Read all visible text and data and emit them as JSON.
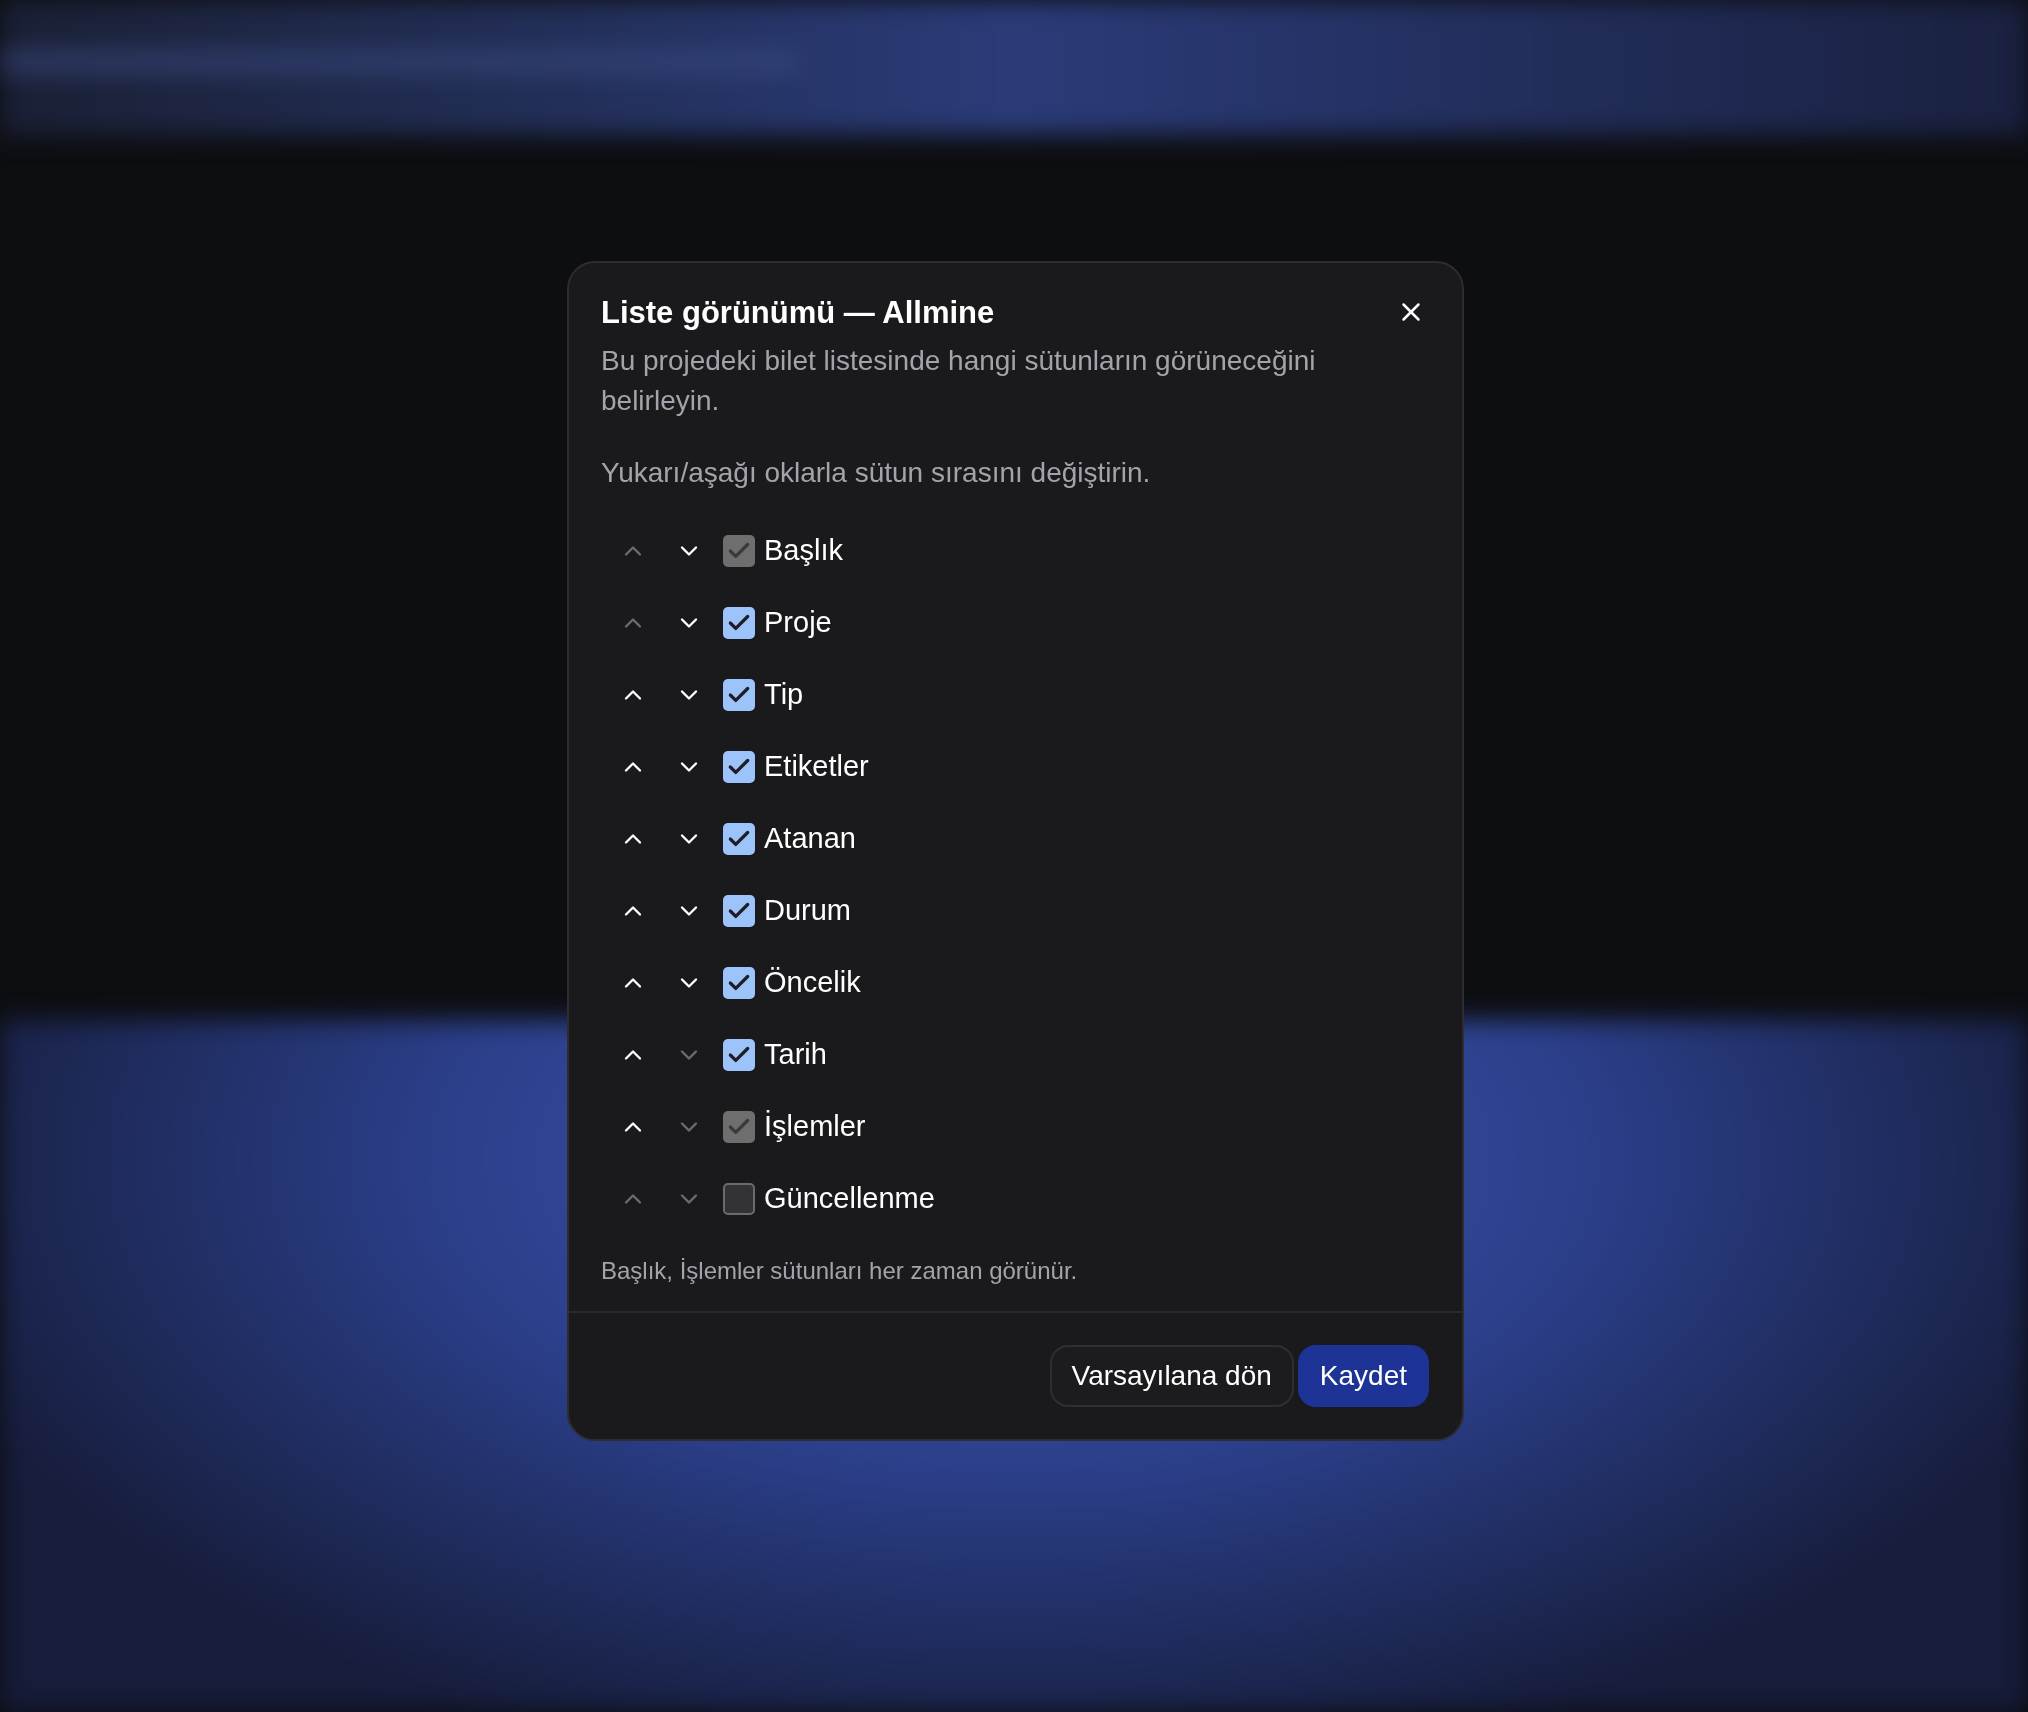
{
  "dialog": {
    "title": "Liste görünümü — Allmine",
    "description": "Bu projedeki bilet listesinde hangi sütunların görüneceğini belirleyin.",
    "hint": "Yukarı/aşağı oklarla sütun sırasını değiştirin.",
    "columns": [
      {
        "label": "Başlık",
        "checked": true,
        "disabled": true,
        "up_disabled": true,
        "down_disabled": false
      },
      {
        "label": "Proje",
        "checked": true,
        "disabled": false,
        "up_disabled": true,
        "down_disabled": false
      },
      {
        "label": "Tip",
        "checked": true,
        "disabled": false,
        "up_disabled": false,
        "down_disabled": false
      },
      {
        "label": "Etiketler",
        "checked": true,
        "disabled": false,
        "up_disabled": false,
        "down_disabled": false
      },
      {
        "label": "Atanan",
        "checked": true,
        "disabled": false,
        "up_disabled": false,
        "down_disabled": false
      },
      {
        "label": "Durum",
        "checked": true,
        "disabled": false,
        "up_disabled": false,
        "down_disabled": false
      },
      {
        "label": "Öncelik",
        "checked": true,
        "disabled": false,
        "up_disabled": false,
        "down_disabled": false
      },
      {
        "label": "Tarih",
        "checked": true,
        "disabled": false,
        "up_disabled": false,
        "down_disabled": true
      },
      {
        "label": "İşlemler",
        "checked": true,
        "disabled": true,
        "up_disabled": false,
        "down_disabled": true
      },
      {
        "label": "Güncellenme",
        "checked": false,
        "disabled": false,
        "up_disabled": true,
        "down_disabled": true
      }
    ],
    "note": "Başlık, İşlemler sütunları her zaman görünür.",
    "buttons": [
      {
        "label": "Varsayılana dön",
        "kind": "secondary"
      },
      {
        "label": "Kaydet",
        "kind": "primary"
      }
    ]
  }
}
